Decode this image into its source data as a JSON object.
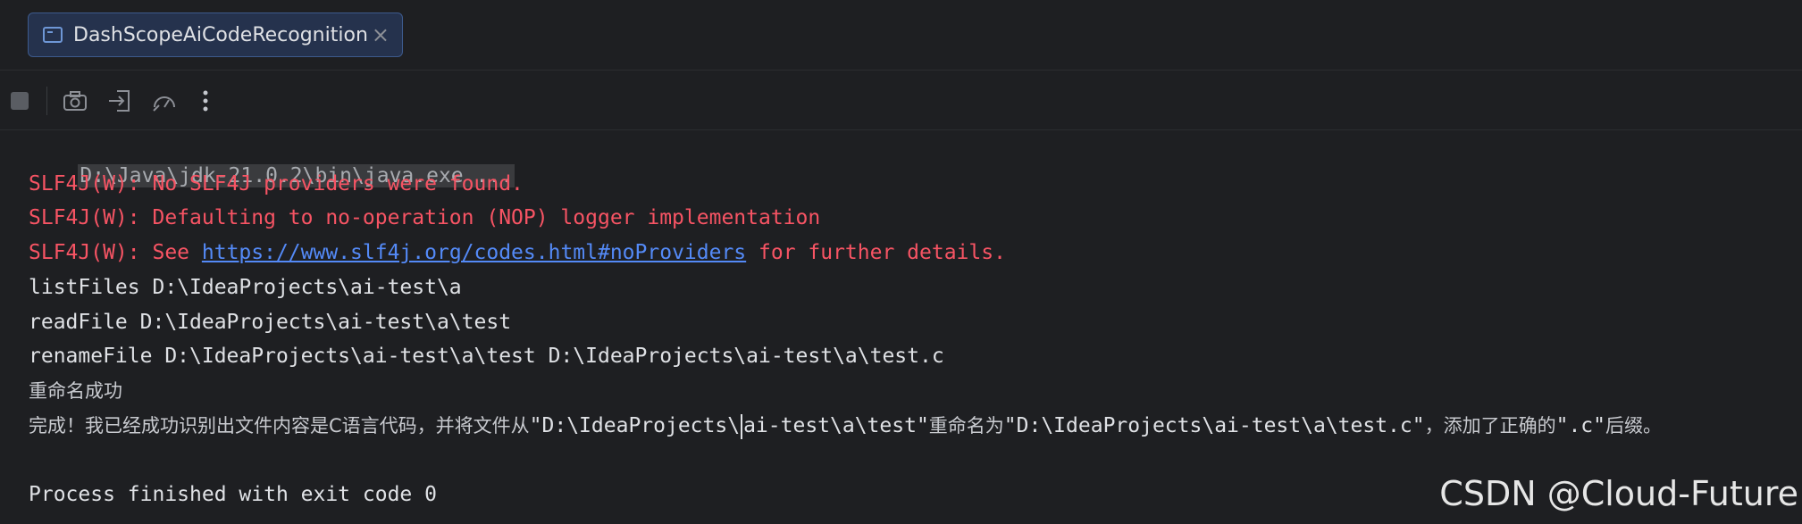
{
  "tab": {
    "title": "DashScopeAiCodeRecognition",
    "close_glyph": "×"
  },
  "toolbar": {
    "icons": [
      "stop-icon",
      "camera-icon",
      "exit-icon",
      "speedometer-icon",
      "more-icon"
    ]
  },
  "console": {
    "lines": [
      {
        "kind": "cmd",
        "text": "D:\\Java\\jdk-21.0.2\\bin\\java.exe ..."
      },
      {
        "kind": "error",
        "text": "SLF4J(W): No SLF4J providers were found."
      },
      {
        "kind": "error",
        "text": "SLF4J(W): Defaulting to no-operation (NOP) logger implementation"
      },
      {
        "kind": "error_link",
        "prefix": "SLF4J(W): See ",
        "link": "https://www.slf4j.org/codes.html#noProviders",
        "suffix": " for further details."
      },
      {
        "kind": "out",
        "text": "listFiles D:\\IdeaProjects\\ai-test\\a"
      },
      {
        "kind": "out",
        "text": "readFile D:\\IdeaProjects\\ai-test\\a\\test"
      },
      {
        "kind": "out",
        "text": "renameFile D:\\IdeaProjects\\ai-test\\a\\test D:\\IdeaProjects\\ai-test\\a\\test.c"
      },
      {
        "kind": "cjk",
        "text": "重命名成功"
      },
      {
        "kind": "mixed",
        "parts": [
          "完成！我已经成功识别出文件内容是C语言代码，并将文件从",
          "\"D:\\IdeaProjects\\",
          "ai-test\\a\\test\"",
          "重命名为",
          "\"D:\\IdeaProjects\\ai-test\\a\\test.c\"",
          "，添加了正确的",
          "\".c\"",
          "后缀。"
        ]
      },
      {
        "kind": "out",
        "text": "Process finished with exit code 0"
      }
    ]
  },
  "watermark": "CSDN @Cloud-Future"
}
